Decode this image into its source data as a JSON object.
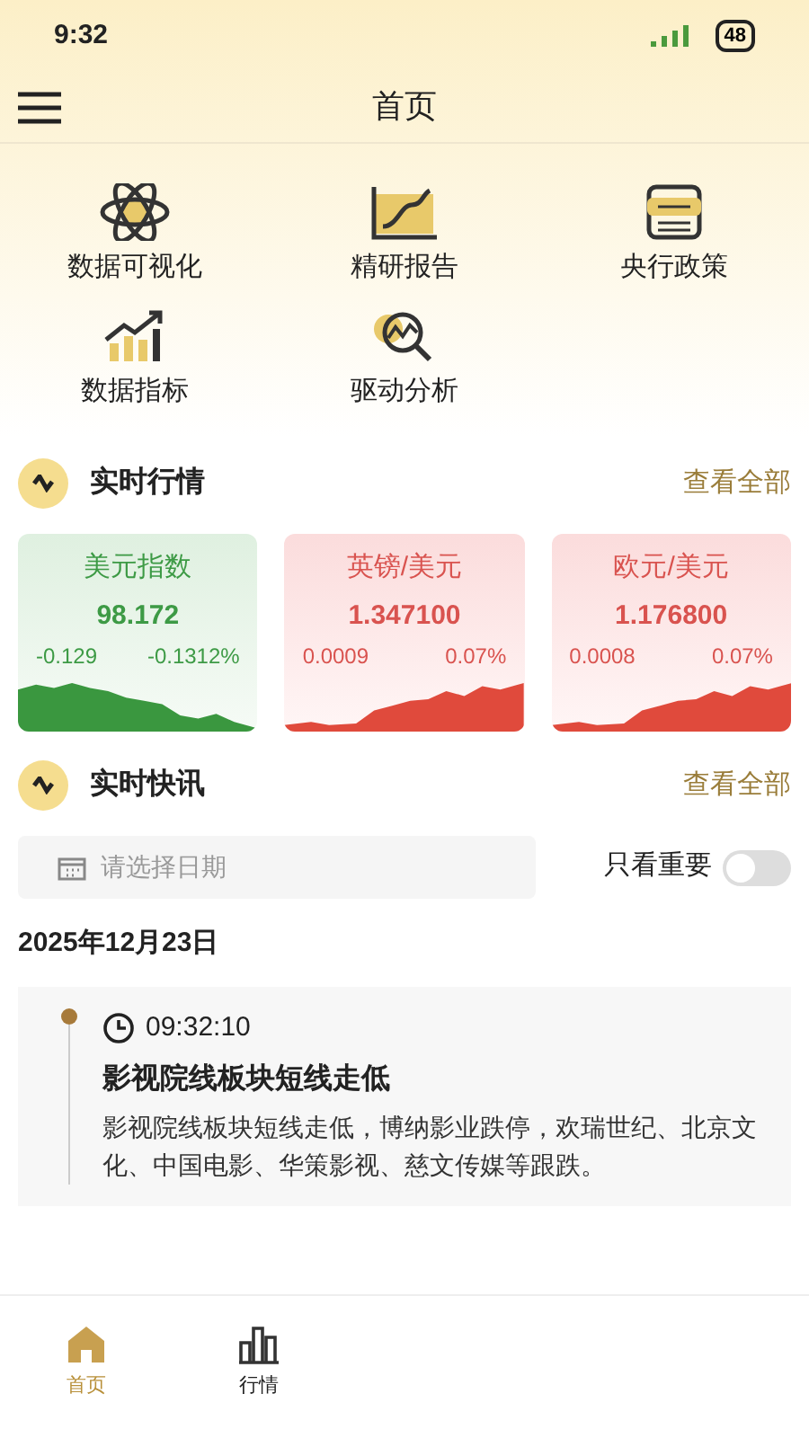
{
  "status_bar": {
    "time": "9:32",
    "battery": "48"
  },
  "header": {
    "title": "首页"
  },
  "shortcuts": [
    {
      "label": "数据可视化",
      "kind": "atom"
    },
    {
      "label": "精研报告",
      "kind": "report"
    },
    {
      "label": "央行政策",
      "kind": "document"
    },
    {
      "label": "数据指标",
      "kind": "growth"
    },
    {
      "label": "驱动分析",
      "kind": "analysis"
    }
  ],
  "market": {
    "title": "实时行情",
    "link": "查看全部",
    "quotes": [
      {
        "name": "美元指数",
        "price": "98.172",
        "change": "-0.129",
        "percent": "-0.1312%",
        "kind": "down"
      },
      {
        "name": "英镑/美元",
        "price": "1.347100",
        "change": "0.0009",
        "percent": "0.07%",
        "kind": "up"
      },
      {
        "name": "欧元/美元",
        "price": "1.176800",
        "change": "0.0008",
        "percent": "0.07%",
        "kind": "up"
      }
    ]
  },
  "news": {
    "title": "实时快讯",
    "link": "查看全部",
    "date_field": {
      "placeholder": "请选择日期"
    },
    "important_only": {
      "label": "只看重要",
      "on": false
    },
    "date": "2025年12月23日",
    "items": [
      {
        "time": "09:32:10",
        "headline": "影视院线板块短线走低",
        "body": "影视院线板块短线走低，博纳影业跌停，欢瑞世纪、北京文化、中国电影、华策影视、慈文传媒等跟跌。"
      }
    ]
  },
  "tabs": [
    {
      "label": "首页",
      "kind": "home",
      "selected": true
    },
    {
      "label": "行情",
      "kind": "chart",
      "selected": false
    }
  ]
}
